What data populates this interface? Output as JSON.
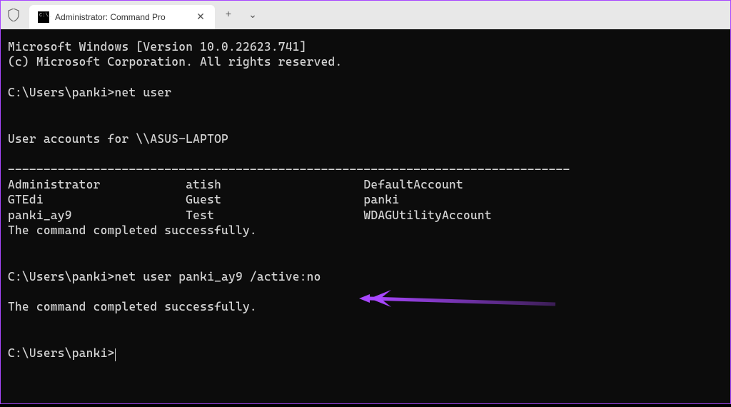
{
  "titlebar": {
    "tab_title": "Administrator: Command Pro",
    "new_tab_label": "+",
    "dropdown_label": "⌄",
    "close_label": "✕"
  },
  "terminal": {
    "banner_line1": "Microsoft Windows [Version 10.0.22623.741]",
    "banner_line2": "(c) Microsoft Corporation. All rights reserved.",
    "prompt1_path": "C:\\Users\\panki>",
    "prompt1_cmd": "net user",
    "accounts_header": "User accounts for \\\\ASUS-LAPTOP",
    "separator": "-------------------------------------------------------------------------------",
    "accounts": {
      "col1": [
        "Administrator",
        "GTEdi",
        "panki_ay9"
      ],
      "col2": [
        "atish",
        "Guest",
        "Test"
      ],
      "col3": [
        "DefaultAccount",
        "panki",
        "WDAGUtilityAccount"
      ]
    },
    "success_msg": "The command completed successfully.",
    "prompt2_path": "C:\\Users\\panki>",
    "prompt2_cmd": "net user panki_ay9 /active:no",
    "prompt3_path": "C:\\Users\\panki>"
  },
  "annotation": {
    "arrow_color": "#a847ff"
  }
}
